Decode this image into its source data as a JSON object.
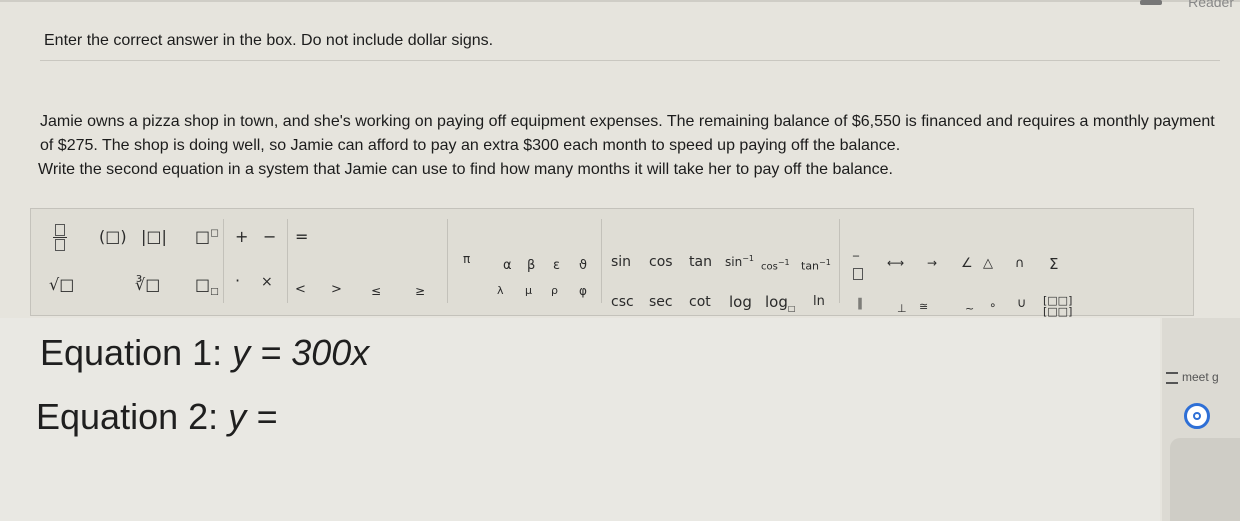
{
  "header": {
    "reader_label": "Reader"
  },
  "instruction": "Enter the correct answer in the box. Do not include dollar signs.",
  "problem_text": "Jamie owns a pizza shop in town, and she's working on paying off equipment expenses. The remaining balance of $6,550 is financed and requires a monthly payment of $275. The shop is doing well, so Jamie can afford to pay an extra $300 each month to speed up paying off the balance.",
  "question": "Write the second equation in a system that Jamie can use to find how many months it will take her to pay off the balance.",
  "toolbar": {
    "row1": [
      "(□)",
      "|□|",
      "□",
      "+",
      "−",
      "=",
      "π",
      "α",
      "β",
      "ε",
      "ϑ",
      "sin",
      "cos",
      "tan",
      "sin",
      "cos",
      "tan",
      "∠",
      "△",
      "∩",
      "Σ"
    ],
    "row2": [
      "√□",
      "∛□",
      "□",
      "·",
      "×",
      "<",
      ">",
      "≤",
      "≥",
      "λ",
      "μ",
      "ρ",
      "φ",
      "csc",
      "sec",
      "cot",
      "log",
      "log",
      "ln",
      "∥",
      "⊥",
      "≅",
      "~",
      "∘",
      "∪"
    ],
    "sup_minus1": "−1"
  },
  "equations": {
    "eq1_label": "Equation 1:",
    "eq1_expr": "y = 300x",
    "eq2_label": "Equation 2:",
    "eq2_expr": "y ="
  },
  "sidebar": {
    "meet_label": "meet g"
  },
  "colors": {
    "accent": "#2e6fd6"
  }
}
